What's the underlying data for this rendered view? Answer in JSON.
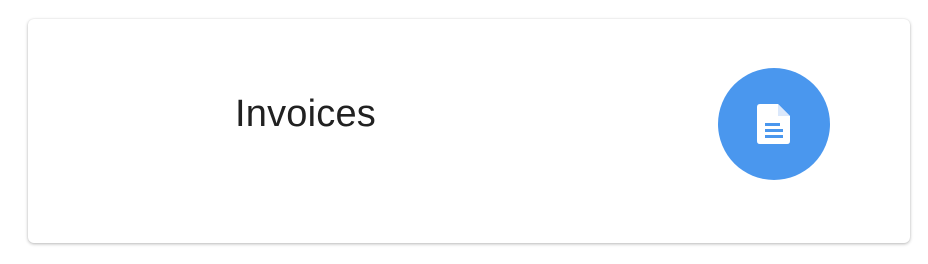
{
  "card": {
    "title": "Invoices",
    "icon": "document-icon",
    "accent_color": "#4A97EE"
  }
}
